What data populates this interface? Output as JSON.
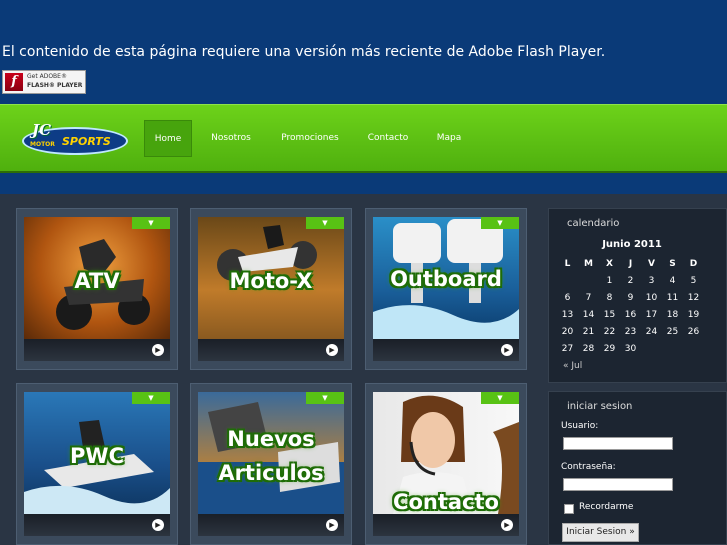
{
  "flash": {
    "message": "El contenido de esta página requiere una versión más reciente de Adobe Flash Player.",
    "badge_line1": "Get ADOBE®",
    "badge_line2": "FLASH® PLAYER"
  },
  "logo": {
    "jc": "JC",
    "motor": "MOTOR",
    "sports": "SPORTS"
  },
  "nav": [
    "Home",
    "Nosotros",
    "Promociones",
    "Contacto",
    "Mapa"
  ],
  "tiles": [
    {
      "label": "ATV"
    },
    {
      "label": "Moto-X"
    },
    {
      "label": "Outboard"
    },
    {
      "label": "PWC"
    },
    {
      "label": "Nuevos Articulos"
    },
    {
      "label": "Contacto"
    }
  ],
  "calendar": {
    "title": "calendario",
    "month": "Junio 2011",
    "days": [
      "L",
      "M",
      "X",
      "J",
      "V",
      "S",
      "D"
    ],
    "weeks": [
      [
        "",
        "",
        "1",
        "2",
        "3",
        "4",
        "5"
      ],
      [
        "6",
        "7",
        "8",
        "9",
        "10",
        "11",
        "12"
      ],
      [
        "13",
        "14",
        "15",
        "16",
        "17",
        "18",
        "19"
      ],
      [
        "20",
        "21",
        "22",
        "23",
        "24",
        "25",
        "26"
      ],
      [
        "27",
        "28",
        "29",
        "30",
        "",
        "",
        ""
      ]
    ],
    "prev": "« Jul"
  },
  "login": {
    "title": "iniciar sesion",
    "user_label": "Usuario:",
    "pass_label": "Contraseña:",
    "remember": "Recordarme",
    "submit": "Iniciar Sesion »"
  }
}
